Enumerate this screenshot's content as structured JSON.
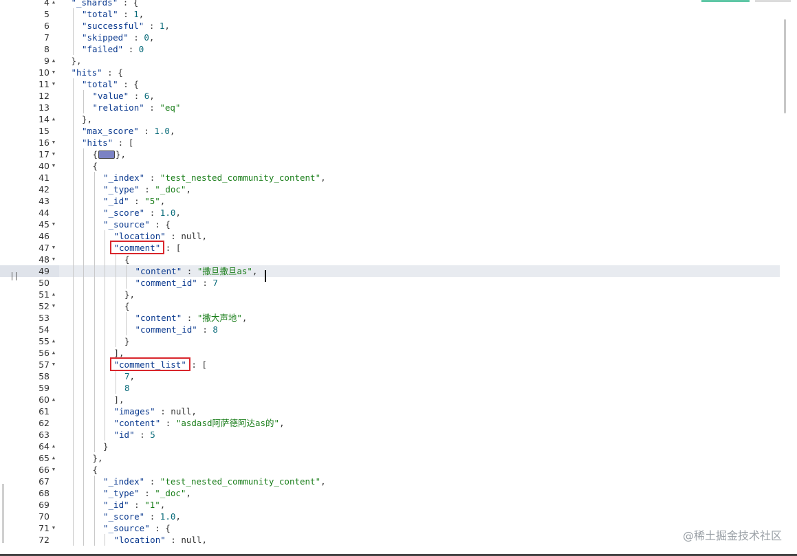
{
  "editor": {
    "lines": [
      {
        "n": "4",
        "fold": "up",
        "indent": 1,
        "text": [
          [
            "k",
            "\"_shards\""
          ],
          [
            "p",
            " : {"
          ]
        ]
      },
      {
        "n": "5",
        "fold": "",
        "indent": 2,
        "text": [
          [
            "k",
            "\"total\""
          ],
          [
            "p",
            " : "
          ],
          [
            "n",
            "1"
          ],
          [
            "p",
            ","
          ]
        ]
      },
      {
        "n": "6",
        "fold": "",
        "indent": 2,
        "text": [
          [
            "k",
            "\"successful\""
          ],
          [
            "p",
            " : "
          ],
          [
            "n",
            "1"
          ],
          [
            "p",
            ","
          ]
        ]
      },
      {
        "n": "7",
        "fold": "",
        "indent": 2,
        "text": [
          [
            "k",
            "\"skipped\""
          ],
          [
            "p",
            " : "
          ],
          [
            "n",
            "0"
          ],
          [
            "p",
            ","
          ]
        ]
      },
      {
        "n": "8",
        "fold": "",
        "indent": 2,
        "text": [
          [
            "k",
            "\"failed\""
          ],
          [
            "p",
            " : "
          ],
          [
            "n",
            "0"
          ]
        ]
      },
      {
        "n": "9",
        "fold": "up",
        "indent": 1,
        "text": [
          [
            "p",
            "},"
          ]
        ]
      },
      {
        "n": "10",
        "fold": "down",
        "indent": 1,
        "text": [
          [
            "k",
            "\"hits\""
          ],
          [
            "p",
            " : {"
          ]
        ]
      },
      {
        "n": "11",
        "fold": "down",
        "indent": 2,
        "text": [
          [
            "k",
            "\"total\""
          ],
          [
            "p",
            " : {"
          ]
        ]
      },
      {
        "n": "12",
        "fold": "",
        "indent": 3,
        "text": [
          [
            "k",
            "\"value\""
          ],
          [
            "p",
            " : "
          ],
          [
            "n",
            "6"
          ],
          [
            "p",
            ","
          ]
        ]
      },
      {
        "n": "13",
        "fold": "",
        "indent": 3,
        "text": [
          [
            "k",
            "\"relation\""
          ],
          [
            "p",
            " : "
          ],
          [
            "s",
            "\"eq\""
          ]
        ]
      },
      {
        "n": "14",
        "fold": "up",
        "indent": 2,
        "text": [
          [
            "p",
            "},"
          ]
        ]
      },
      {
        "n": "15",
        "fold": "",
        "indent": 2,
        "text": [
          [
            "k",
            "\"max_score\""
          ],
          [
            "p",
            " : "
          ],
          [
            "n",
            "1.0"
          ],
          [
            "p",
            ","
          ]
        ]
      },
      {
        "n": "16",
        "fold": "down",
        "indent": 2,
        "text": [
          [
            "k",
            "\"hits\""
          ],
          [
            "p",
            " : ["
          ]
        ]
      },
      {
        "n": "17",
        "fold": "down",
        "indent": 3,
        "text": [
          [
            "p",
            "{"
          ],
          [
            "c",
            ""
          ],
          [
            "p",
            "},"
          ]
        ]
      },
      {
        "n": "40",
        "fold": "down",
        "indent": 3,
        "text": [
          [
            "p",
            "{"
          ]
        ]
      },
      {
        "n": "41",
        "fold": "",
        "indent": 4,
        "text": [
          [
            "k",
            "\"_index\""
          ],
          [
            "p",
            " : "
          ],
          [
            "s",
            "\"test_nested_community_content\""
          ],
          [
            "p",
            ","
          ]
        ]
      },
      {
        "n": "42",
        "fold": "",
        "indent": 4,
        "text": [
          [
            "k",
            "\"_type\""
          ],
          [
            "p",
            " : "
          ],
          [
            "s",
            "\"_doc\""
          ],
          [
            "p",
            ","
          ]
        ]
      },
      {
        "n": "43",
        "fold": "",
        "indent": 4,
        "text": [
          [
            "k",
            "\"_id\""
          ],
          [
            "p",
            " : "
          ],
          [
            "s",
            "\"5\""
          ],
          [
            "p",
            ","
          ]
        ]
      },
      {
        "n": "44",
        "fold": "",
        "indent": 4,
        "text": [
          [
            "k",
            "\"_score\""
          ],
          [
            "p",
            " : "
          ],
          [
            "n",
            "1.0"
          ],
          [
            "p",
            ","
          ]
        ]
      },
      {
        "n": "45",
        "fold": "down",
        "indent": 4,
        "text": [
          [
            "k",
            "\"_source\""
          ],
          [
            "p",
            " : {"
          ]
        ]
      },
      {
        "n": "46",
        "fold": "",
        "indent": 5,
        "text": [
          [
            "k",
            "\"location\""
          ],
          [
            "p",
            " : "
          ],
          [
            "x",
            "null"
          ],
          [
            "p",
            ","
          ]
        ]
      },
      {
        "n": "47",
        "fold": "down",
        "indent": 5,
        "text": [
          [
            "k",
            "\"comment\""
          ],
          [
            "p",
            " : ["
          ]
        ]
      },
      {
        "n": "48",
        "fold": "down",
        "indent": 6,
        "text": [
          [
            "p",
            "{"
          ]
        ]
      },
      {
        "n": "49",
        "fold": "",
        "indent": 7,
        "text": [
          [
            "k",
            "\"content\""
          ],
          [
            "p",
            " : "
          ],
          [
            "s",
            "\"撒旦撒旦as\""
          ],
          [
            "p",
            ","
          ]
        ]
      },
      {
        "n": "50",
        "fold": "",
        "indent": 7,
        "text": [
          [
            "k",
            "\"comment_id\""
          ],
          [
            "p",
            " : "
          ],
          [
            "n",
            "7"
          ]
        ]
      },
      {
        "n": "51",
        "fold": "up",
        "indent": 6,
        "text": [
          [
            "p",
            "},"
          ]
        ]
      },
      {
        "n": "52",
        "fold": "down",
        "indent": 6,
        "text": [
          [
            "p",
            "{"
          ]
        ]
      },
      {
        "n": "53",
        "fold": "",
        "indent": 7,
        "text": [
          [
            "k",
            "\"content\""
          ],
          [
            "p",
            " : "
          ],
          [
            "s",
            "\"撒大声地\""
          ],
          [
            "p",
            ","
          ]
        ]
      },
      {
        "n": "54",
        "fold": "",
        "indent": 7,
        "text": [
          [
            "k",
            "\"comment_id\""
          ],
          [
            "p",
            " : "
          ],
          [
            "n",
            "8"
          ]
        ]
      },
      {
        "n": "55",
        "fold": "up",
        "indent": 6,
        "text": [
          [
            "p",
            "}"
          ]
        ]
      },
      {
        "n": "56",
        "fold": "up",
        "indent": 5,
        "text": [
          [
            "p",
            "],"
          ]
        ]
      },
      {
        "n": "57",
        "fold": "down",
        "indent": 5,
        "text": [
          [
            "k",
            "\"comment_list\""
          ],
          [
            "p",
            " : ["
          ]
        ]
      },
      {
        "n": "58",
        "fold": "",
        "indent": 6,
        "text": [
          [
            "n",
            "7"
          ],
          [
            "p",
            ","
          ]
        ]
      },
      {
        "n": "59",
        "fold": "",
        "indent": 6,
        "text": [
          [
            "n",
            "8"
          ]
        ]
      },
      {
        "n": "60",
        "fold": "up",
        "indent": 5,
        "text": [
          [
            "p",
            "],"
          ]
        ]
      },
      {
        "n": "61",
        "fold": "",
        "indent": 5,
        "text": [
          [
            "k",
            "\"images\""
          ],
          [
            "p",
            " : "
          ],
          [
            "x",
            "null"
          ],
          [
            "p",
            ","
          ]
        ]
      },
      {
        "n": "62",
        "fold": "",
        "indent": 5,
        "text": [
          [
            "k",
            "\"content\""
          ],
          [
            "p",
            " : "
          ],
          [
            "s",
            "\"asdasd阿萨德阿达as的\""
          ],
          [
            "p",
            ","
          ]
        ]
      },
      {
        "n": "63",
        "fold": "",
        "indent": 5,
        "text": [
          [
            "k",
            "\"id\""
          ],
          [
            "p",
            " : "
          ],
          [
            "n",
            "5"
          ]
        ]
      },
      {
        "n": "64",
        "fold": "up",
        "indent": 4,
        "text": [
          [
            "p",
            "}"
          ]
        ]
      },
      {
        "n": "65",
        "fold": "up",
        "indent": 3,
        "text": [
          [
            "p",
            "},"
          ]
        ]
      },
      {
        "n": "66",
        "fold": "down",
        "indent": 3,
        "text": [
          [
            "p",
            "{"
          ]
        ]
      },
      {
        "n": "67",
        "fold": "",
        "indent": 4,
        "text": [
          [
            "k",
            "\"_index\""
          ],
          [
            "p",
            " : "
          ],
          [
            "s",
            "\"test_nested_community_content\""
          ],
          [
            "p",
            ","
          ]
        ]
      },
      {
        "n": "68",
        "fold": "",
        "indent": 4,
        "text": [
          [
            "k",
            "\"_type\""
          ],
          [
            "p",
            " : "
          ],
          [
            "s",
            "\"_doc\""
          ],
          [
            "p",
            ","
          ]
        ]
      },
      {
        "n": "69",
        "fold": "",
        "indent": 4,
        "text": [
          [
            "k",
            "\"_id\""
          ],
          [
            "p",
            " : "
          ],
          [
            "s",
            "\"1\""
          ],
          [
            "p",
            ","
          ]
        ]
      },
      {
        "n": "70",
        "fold": "",
        "indent": 4,
        "text": [
          [
            "k",
            "\"_score\""
          ],
          [
            "p",
            " : "
          ],
          [
            "n",
            "1.0"
          ],
          [
            "p",
            ","
          ]
        ]
      },
      {
        "n": "71",
        "fold": "down",
        "indent": 4,
        "text": [
          [
            "k",
            "\"_source\""
          ],
          [
            "p",
            " : {"
          ]
        ]
      },
      {
        "n": "72",
        "fold": "",
        "indent": 5,
        "text": [
          [
            "k",
            "\"location\""
          ],
          [
            "p",
            " : "
          ],
          [
            "x",
            "null"
          ],
          [
            "p",
            ","
          ]
        ]
      }
    ],
    "active_line": "49",
    "highlighted_keys": [
      "\"comment\"",
      "\"comment_list\""
    ]
  },
  "watermark": "@稀土掘金技术社区",
  "colors": {
    "key": "#0b3a8f",
    "string": "#1a7e1a",
    "number": "#0a6b7a",
    "highlight_box": "#d9262c",
    "active_line": "#e8ebf0"
  }
}
